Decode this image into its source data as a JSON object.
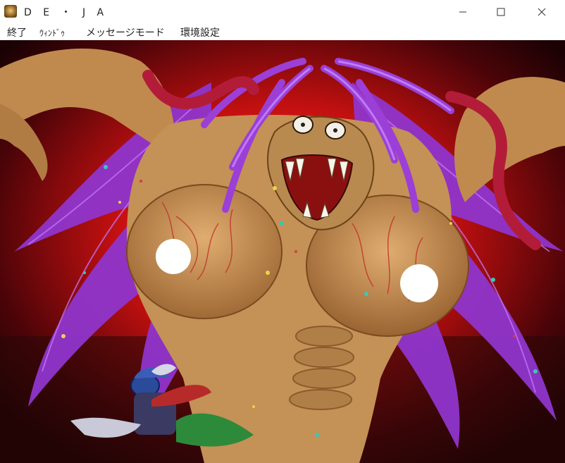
{
  "window": {
    "title": "D E ・ J A",
    "icons": {
      "app": "game-app-icon",
      "minimize": "minimize-icon",
      "maximize": "maximize-icon",
      "close": "close-icon"
    }
  },
  "menu": {
    "items": [
      {
        "label": "終了"
      },
      {
        "label": "ｳｨﾝﾄﾞｩ"
      },
      {
        "label": "メッセージモード"
      },
      {
        "label": "環境設定"
      }
    ]
  },
  "scene": {
    "colors": {
      "background_red": "#c41010",
      "hair": "#9b3fd6",
      "skin": "#c99558",
      "tentacle": "#b31c38",
      "censor": "#ffffff"
    }
  }
}
